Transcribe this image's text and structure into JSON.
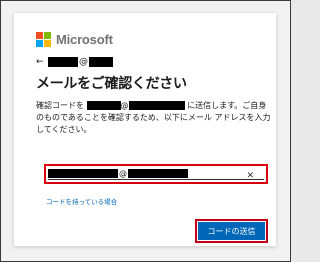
{
  "brand": {
    "name": "Microsoft",
    "logo_colors": [
      "#f25022",
      "#7fba00",
      "#00a4ef",
      "#ffb900"
    ]
  },
  "identity": {
    "back_icon": "arrow-left-icon",
    "at": "@"
  },
  "heading": "メールをご確認ください",
  "description": {
    "prefix": "確認コードを",
    "at": "@",
    "suffix": "に送信します。ご自身のものであることを確認するため、以下にメール アドレスを入力してください。"
  },
  "email_input": {
    "at": "@",
    "clear_icon": "close-icon",
    "highlight_color": "#d9000d"
  },
  "have_code_link": "コードを持っている場合",
  "send_button": {
    "label": "コードの送信",
    "color": "#0067b8",
    "highlight_color": "#c0001a"
  }
}
